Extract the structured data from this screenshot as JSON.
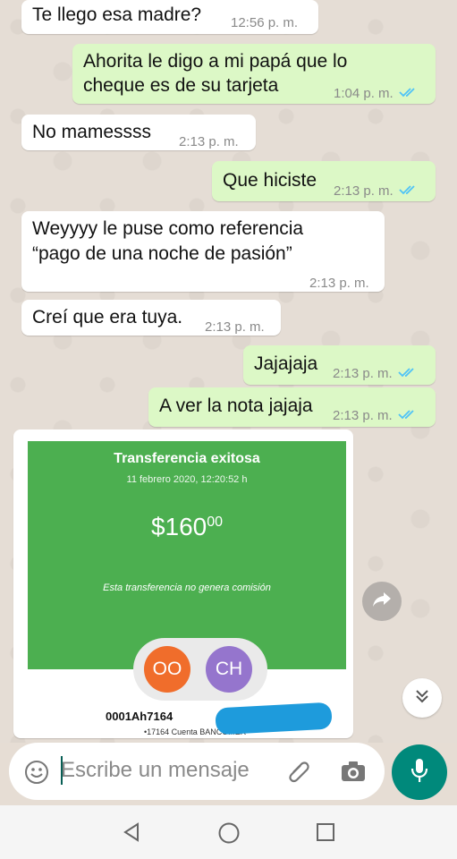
{
  "messages": [
    {
      "direction": "in",
      "text": "Te llego esa madre?",
      "time": "12:56 p. m."
    },
    {
      "direction": "out",
      "lines": [
        "Ahorita le digo a mi papá que lo",
        "cheque es de su tarjeta"
      ],
      "time": "1:04 p. m."
    },
    {
      "direction": "in",
      "text": "No mamessss",
      "time": "2:13 p. m."
    },
    {
      "direction": "out",
      "text": "Que hiciste",
      "time": "2:13 p. m."
    },
    {
      "direction": "in",
      "lines": [
        "Weyyyy le puse como referencia",
        "“pago de una noche de pasión”"
      ],
      "time": "2:13 p. m."
    },
    {
      "direction": "in",
      "text": "Creí que era tuya.",
      "time": "2:13 p. m."
    },
    {
      "direction": "out",
      "text": "Jajajaja",
      "time": "2:13 p. m."
    },
    {
      "direction": "out",
      "text": "A ver la nota jajaja",
      "time": "2:13 p. m."
    }
  ],
  "receipt": {
    "title": "Transferencia exitosa",
    "date": "11 febrero 2020, 12:20:52 h",
    "amount_main": "$160",
    "amount_cents": "00",
    "note": "Esta transferencia no genera comisión",
    "avatar_left": "OO",
    "avatar_right": "CH",
    "account": "0001Ah7164",
    "account_tail": "...",
    "account_sub": "•17164 Cuenta BANCOMER"
  },
  "composer": {
    "placeholder": "Escribe un mensaje"
  },
  "icons": {
    "emoji": "emoji-icon",
    "attach": "paperclip-icon",
    "camera": "camera-icon",
    "mic": "mic-icon",
    "share": "share-icon",
    "scroll_down": "double-chevron-down-icon",
    "nav_back": "back-triangle-icon",
    "nav_home": "home-circle-icon",
    "nav_recents": "recents-square-icon"
  },
  "colors": {
    "outgoing_bubble": "#dcf8c6",
    "incoming_bubble": "#ffffff",
    "read_ticks": "#4fc3f7",
    "accent": "#00897b",
    "receipt_green": "#4caf50"
  }
}
